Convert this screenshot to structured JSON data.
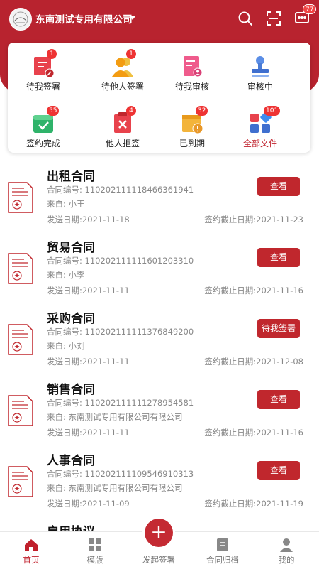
{
  "header": {
    "company_name": "东南测试专用有限公司",
    "notification_badge": "77"
  },
  "quick_actions": [
    {
      "label": "待我签署",
      "badge": "1"
    },
    {
      "label": "待他人签署",
      "badge": "1"
    },
    {
      "label": "待我审核",
      "badge": ""
    },
    {
      "label": "审核中",
      "badge": ""
    },
    {
      "label": "签约完成",
      "badge": "55"
    },
    {
      "label": "他人拒签",
      "badge": "4"
    },
    {
      "label": "已到期",
      "badge": "32"
    },
    {
      "label": "全部文件",
      "badge": "101"
    }
  ],
  "contracts": [
    {
      "title": "出租合同",
      "number": "合同编号: 110202111118466361941",
      "from": "来自: 小王",
      "sent": "发送日期:2021-11-18",
      "deadline": "签约截止日期:2021-11-23",
      "button": "查看"
    },
    {
      "title": "贸易合同",
      "number": "合同编号: 110202111111601203310",
      "from": "来自: 小李",
      "sent": "发送日期:2021-11-11",
      "deadline": "签约截止日期:2021-11-16",
      "button": "查看"
    },
    {
      "title": "采购合同",
      "number": "合同编号: 110202111111376849200",
      "from": "来自: 小刘",
      "sent": "发送日期:2021-11-11",
      "deadline": "签约截止日期:2021-12-08",
      "button": "待我签署"
    },
    {
      "title": "销售合同",
      "number": "合同编号: 110202111111278954581",
      "from": "来自: 东南测试专用有限公司有限公司",
      "sent": "发送日期:2021-11-11",
      "deadline": "签约截止日期:2021-11-16",
      "button": "查看"
    },
    {
      "title": "人事合同",
      "number": "合同编号: 110202111109546910313",
      "from": "来自: 东南测试专用有限公司有限公司",
      "sent": "发送日期:2021-11-09",
      "deadline": "签约截止日期:2021-11-19",
      "button": "查看"
    },
    {
      "title": "启用协议",
      "number": "",
      "from": "",
      "sent": "",
      "deadline": "",
      "button": ""
    }
  ],
  "tabbar": {
    "home": "首页",
    "templates": "模版",
    "start_sign": "发起签署",
    "archive": "合同归档",
    "mine": "我的"
  },
  "colors": {
    "brand": "#b8232f",
    "button": "#c0272d",
    "active_tab": "#c0202c"
  }
}
